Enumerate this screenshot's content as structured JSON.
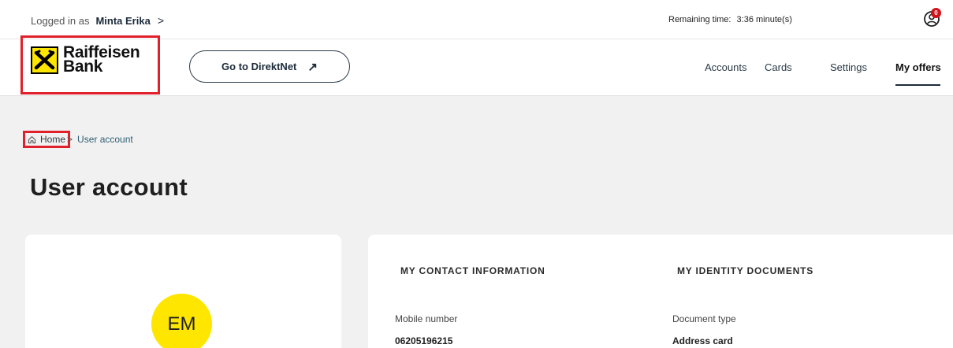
{
  "topbar": {
    "logged_in_label": "Logged in as",
    "user_name": "Minta Erika",
    "chevron": ">",
    "remaining_label": "Remaining time:",
    "remaining_value": "3:36 minute(s)",
    "notification_count": "0"
  },
  "header": {
    "logo_line1": "Raiffeisen",
    "logo_line2": "Bank",
    "direktnet_label": "Go to DirektNet",
    "direktnet_arrow": "↗",
    "nav": [
      {
        "label": "Accounts"
      },
      {
        "label": "Cards"
      },
      {
        "label": "Settings"
      },
      {
        "label": "My offers",
        "active": true
      }
    ]
  },
  "breadcrumb": {
    "home": "Home",
    "separator": ">",
    "current": "User account"
  },
  "page": {
    "title": "User account"
  },
  "profile": {
    "initials": "EM"
  },
  "contact": {
    "section_title": "MY CONTACT INFORMATION",
    "mobile_label": "Mobile number",
    "mobile_value": "06205196215"
  },
  "identity": {
    "section_title": "MY IDENTITY DOCUMENTS",
    "doc_type_label": "Document type",
    "doc_type_value": "Address card"
  },
  "colors": {
    "brand_yellow": "#fee600",
    "highlight_red": "#e0202a",
    "badge_red": "#d0121b",
    "page_bg": "#f2f1f1"
  }
}
